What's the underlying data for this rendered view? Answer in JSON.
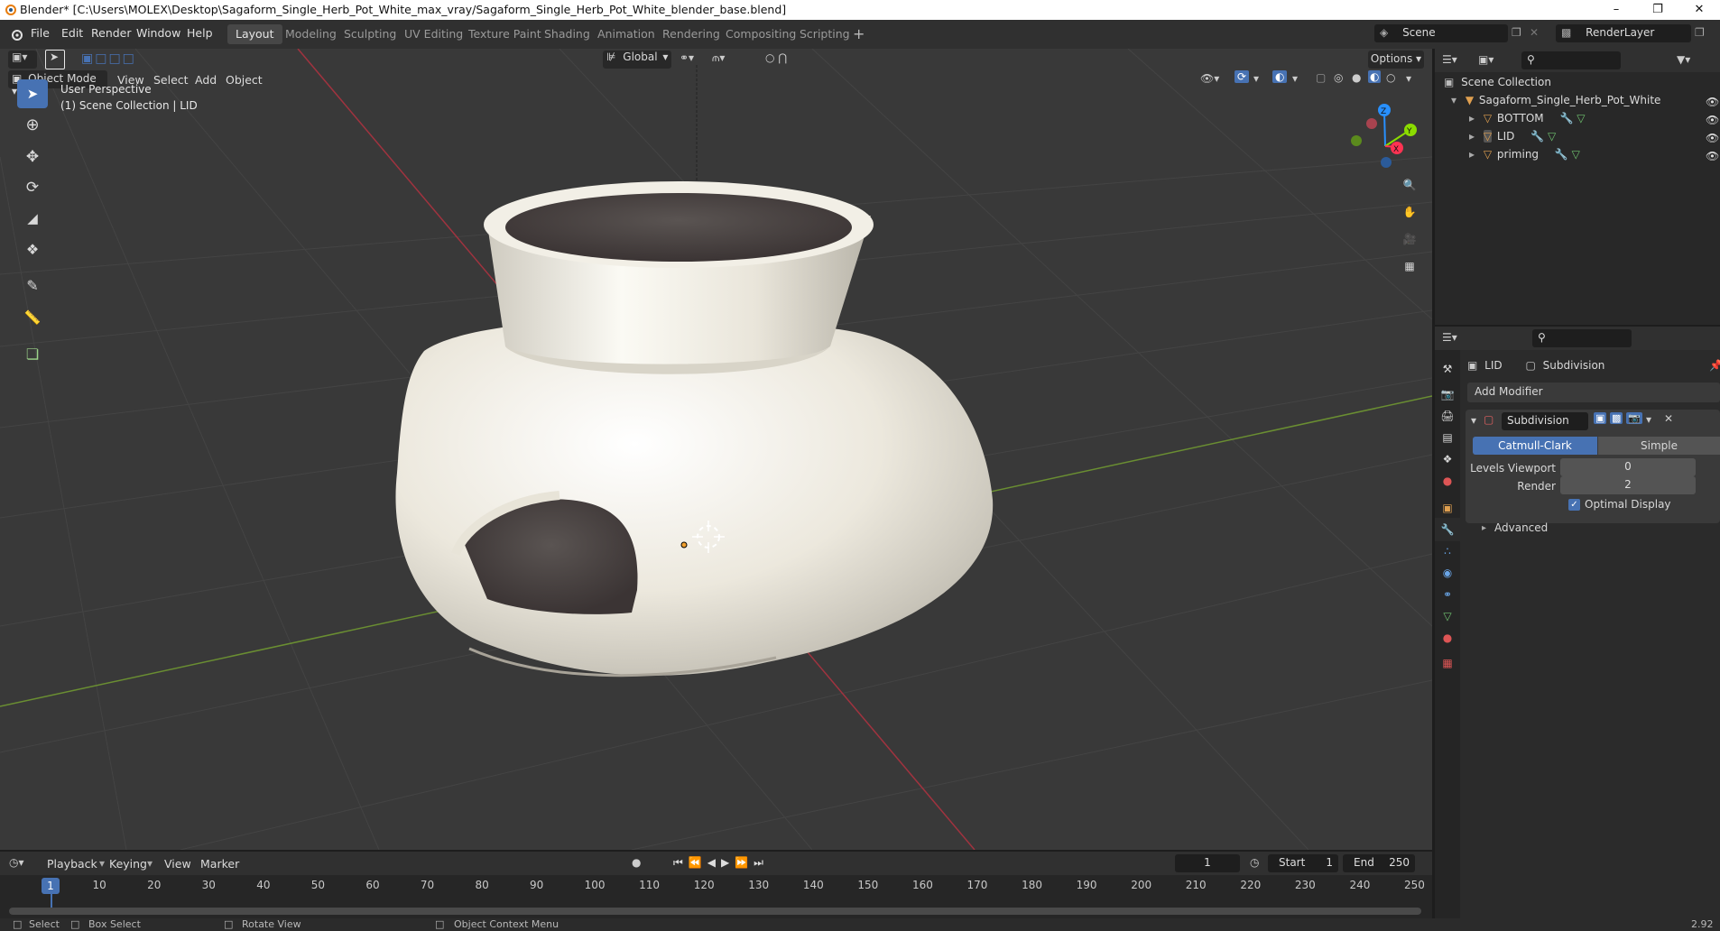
{
  "title": "Blender* [C:\\Users\\MOLEX\\Desktop\\Sagaform_Single_Herb_Pot_White_max_vray/Sagaform_Single_Herb_Pot_White_blender_base.blend]",
  "menus": [
    "File",
    "Edit",
    "Render",
    "Window",
    "Help"
  ],
  "workspaces": [
    "Layout",
    "Modeling",
    "Sculpting",
    "UV Editing",
    "Texture Paint",
    "Shading",
    "Animation",
    "Rendering",
    "Compositing",
    "Scripting"
  ],
  "active_workspace": "Layout",
  "scene": "Scene",
  "render_layer": "RenderLayer",
  "viewport": {
    "mode": "Object Mode",
    "menus": [
      "View",
      "Select",
      "Add",
      "Object"
    ],
    "transform_orientation": "Global",
    "options": "Options",
    "info_line1": "User Perspective",
    "info_line2": "(1) Scene Collection | LID",
    "gizmo": {
      "x": "X",
      "y": "Y",
      "z": "Z"
    }
  },
  "outliner": {
    "root": "Scene Collection",
    "collection": "Sagaform_Single_Herb_Pot_White",
    "objects": [
      "BOTTOM",
      "LID",
      "priming"
    ]
  },
  "properties": {
    "object": "LID",
    "modifier_crumb": "Subdivision",
    "add_modifier": "Add Modifier",
    "modifier_name": "Subdivision",
    "algorithms": [
      "Catmull-Clark",
      "Simple"
    ],
    "active_algorithm": "Catmull-Clark",
    "levels_viewport_label": "Levels Viewport",
    "levels_viewport": "0",
    "render_label": "Render",
    "render_value": "2",
    "optimal_display": "Optimal Display",
    "optimal_display_checked": true,
    "advanced": "Advanced"
  },
  "timeline": {
    "menus": [
      "Playback",
      "Keying",
      "View",
      "Marker"
    ],
    "current_frame": "1",
    "start_label": "Start",
    "start": "1",
    "end_label": "End",
    "end": "250",
    "ticks": [
      "1",
      "10",
      "20",
      "30",
      "40",
      "50",
      "60",
      "70",
      "80",
      "90",
      "100",
      "110",
      "120",
      "130",
      "140",
      "150",
      "160",
      "170",
      "180",
      "190",
      "200",
      "210",
      "220",
      "230",
      "240",
      "250"
    ]
  },
  "status": {
    "select": "Select",
    "box_select": "Box Select",
    "rotate_view": "Rotate View",
    "context_menu": "Object Context Menu",
    "version": "2.92"
  },
  "colors": {
    "accent": "#4772b3",
    "x_axis": "#ff3352",
    "y_axis": "#8bdc00",
    "z_axis": "#2890ff",
    "pot": "#efece2"
  }
}
